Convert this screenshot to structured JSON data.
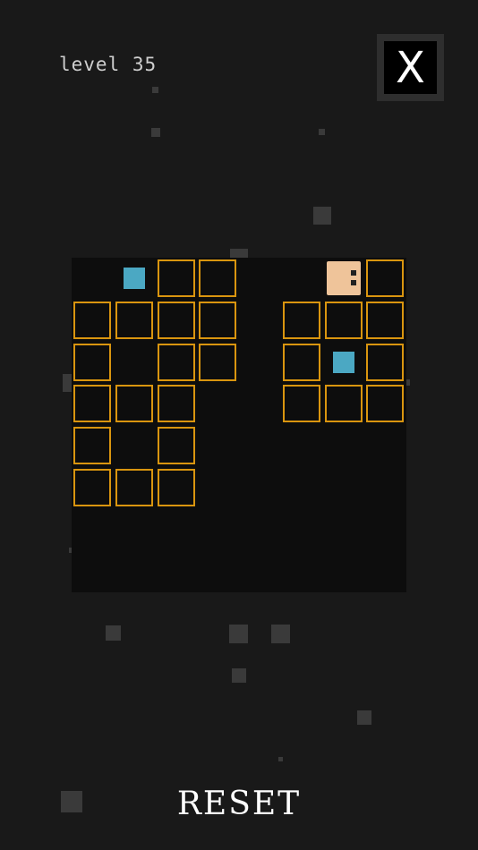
{
  "header": {
    "level_text": "level 35"
  },
  "close_button": {
    "label": "X"
  },
  "board": {
    "grid_size": 8,
    "tiles": [
      [
        0,
        2
      ],
      [
        0,
        3
      ],
      [
        0,
        7
      ],
      [
        1,
        0
      ],
      [
        1,
        1
      ],
      [
        1,
        2
      ],
      [
        1,
        3
      ],
      [
        1,
        5
      ],
      [
        1,
        6
      ],
      [
        1,
        7
      ],
      [
        2,
        0
      ],
      [
        2,
        2
      ],
      [
        2,
        3
      ],
      [
        2,
        5
      ],
      [
        2,
        7
      ],
      [
        3,
        0
      ],
      [
        3,
        1
      ],
      [
        3,
        2
      ],
      [
        3,
        5
      ],
      [
        3,
        6
      ],
      [
        3,
        7
      ],
      [
        4,
        0
      ],
      [
        4,
        2
      ],
      [
        5,
        0
      ],
      [
        5,
        1
      ],
      [
        5,
        2
      ]
    ],
    "gems": [
      [
        0,
        1
      ],
      [
        2,
        6
      ]
    ],
    "player": [
      0,
      6
    ]
  },
  "footer": {
    "reset_label": "RESET"
  },
  "colors": {
    "background": "#191919",
    "board": "#0d0d0d",
    "tile_border": "#d9950f",
    "gem": "#4ba8c3",
    "player": "#efc49a",
    "particle": "#555555"
  }
}
